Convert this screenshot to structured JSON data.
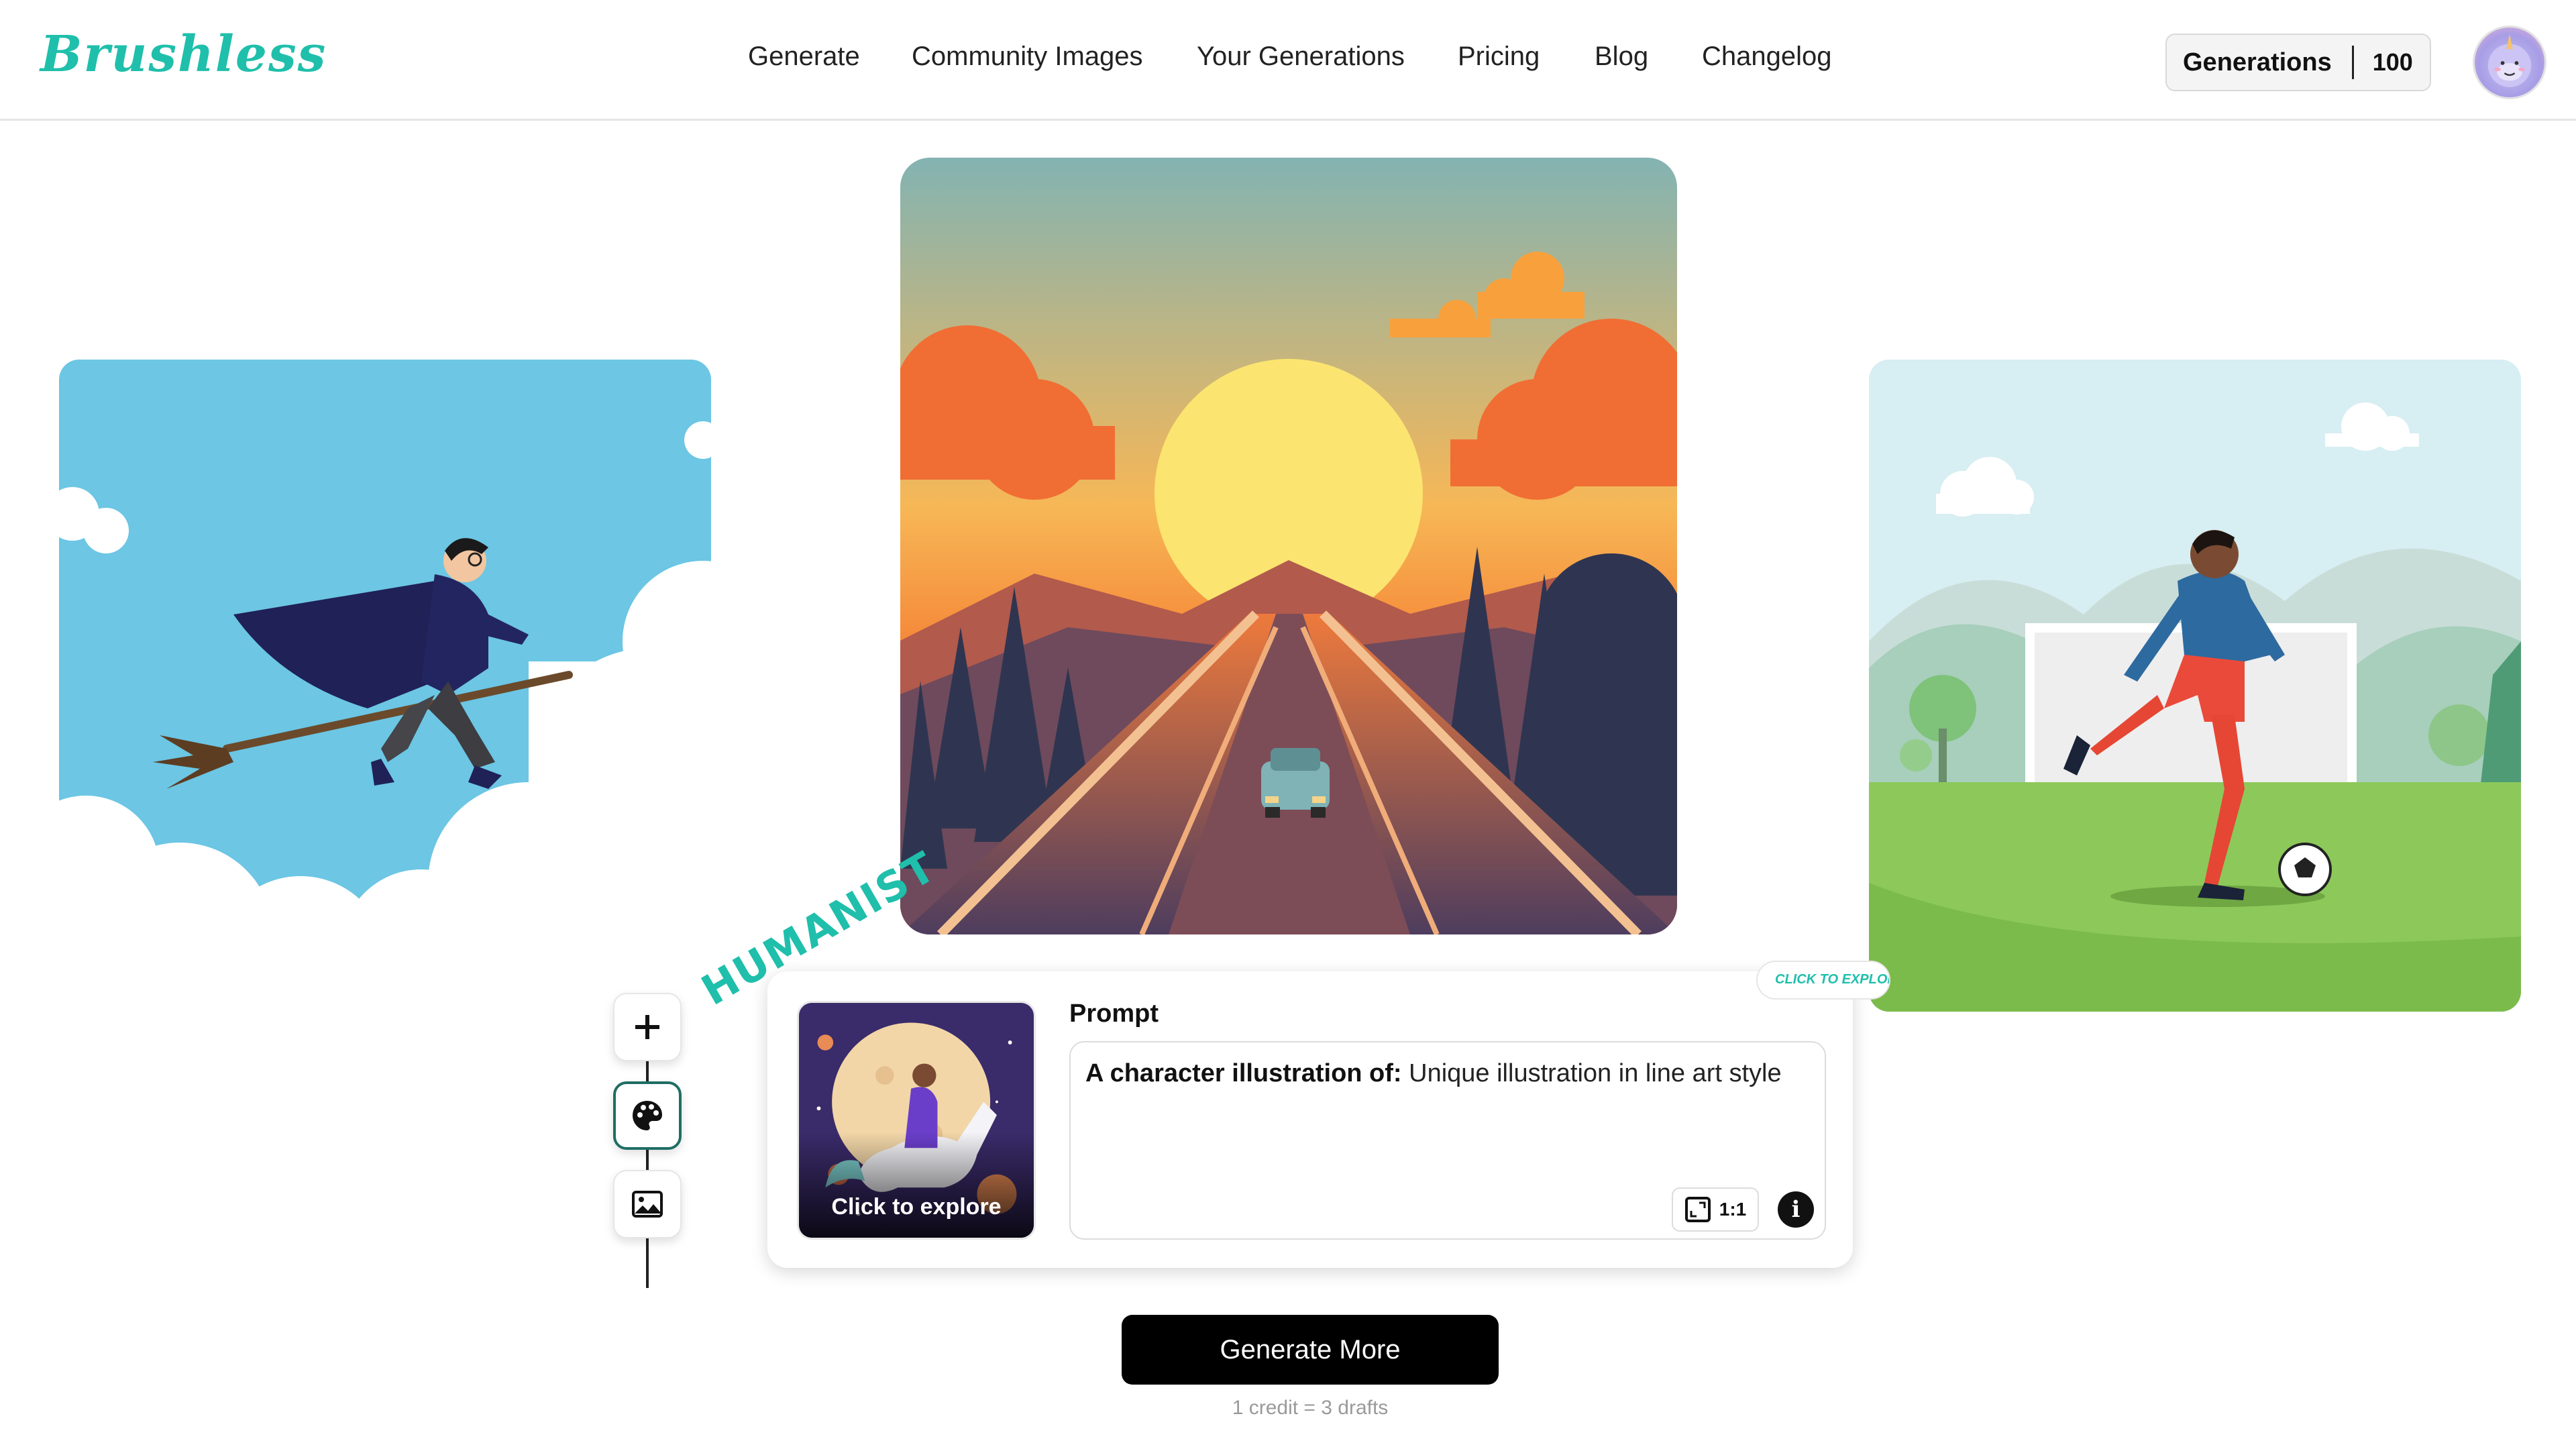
{
  "brand": {
    "logo": "Brushless",
    "accent": "#1fbfab"
  },
  "nav": [
    {
      "label": "Generate"
    },
    {
      "label": "Community Images"
    },
    {
      "label": "Your Generations"
    },
    {
      "label": "Pricing"
    },
    {
      "label": "Blog"
    },
    {
      "label": "Changelog"
    }
  ],
  "account": {
    "generations_label": "Generations",
    "generations_count": "100"
  },
  "gallery": {
    "left": {
      "icon": "wizard-on-broom-image"
    },
    "center": {
      "icon": "sunset-road-image"
    },
    "right": {
      "icon": "soccer-player-image"
    }
  },
  "toolbar": {
    "add_icon": "plus-icon",
    "style_icon": "palette-icon",
    "image_icon": "image-icon"
  },
  "style": {
    "name": "HUMANIST",
    "hint": "CLICK TO EXPLORE",
    "thumbnail_label": "Click to explore"
  },
  "prompt": {
    "label": "Prompt",
    "prefix": "A character illustration of:",
    "text": "Unique illustration in line art style",
    "aspect_ratio": "1:1"
  },
  "actions": {
    "generate_label": "Generate More",
    "credit_note": "1 credit = 3 drafts"
  }
}
